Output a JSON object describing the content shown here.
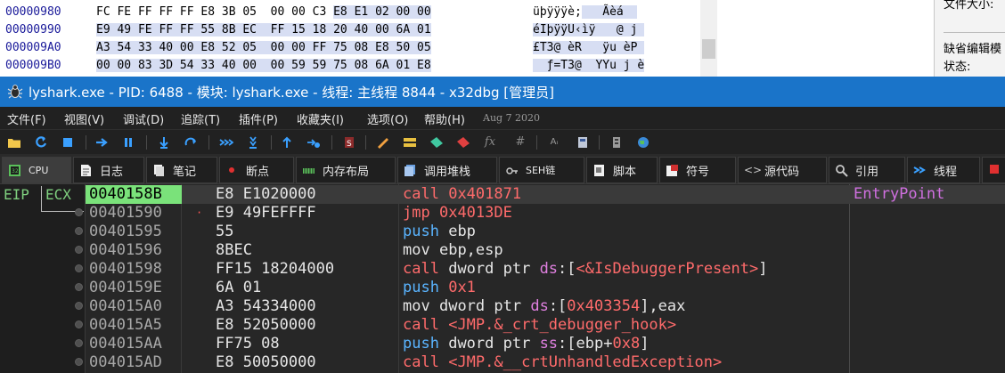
{
  "hexdump": {
    "rows": [
      {
        "addr": "00000980",
        "bytes_a": "FC FE FF FF FF E8 3B 05  00 00 C3 ",
        "bytes_b": "E8 E1 02 00 00",
        "ascii_a": "üþÿÿÿè;",
        "ascii_b": "   Ãèá  "
      },
      {
        "addr": "00000990",
        "bytes_a": "",
        "bytes_b": "E9 49 FE FF FF 55 8B EC  FF 15 18 20 40 00 6A 01",
        "ascii_a": "",
        "ascii_b": "éIþÿÿU‹ìÿ   @ j "
      },
      {
        "addr": "000009A0",
        "bytes_a": "",
        "bytes_b": "A3 54 33 40 00 E8 52 05  00 00 FF 75 08 E8 50 05",
        "ascii_a": "",
        "ascii_b": "£T3@ èR   ÿu èP "
      },
      {
        "addr": "000009B0",
        "bytes_a": "",
        "bytes_b": "00 00 83 3D 54 33 40 00  00 59 59 75 08 6A 01 E8",
        "ascii_a": "",
        "ascii_b": "  ƒ=T3@  YYu j è"
      }
    ]
  },
  "right_panel": {
    "line1": "文件大小:",
    "line2": "缺省编辑模",
    "line3": "状态:"
  },
  "titlebar": {
    "title": "lyshark.exe - PID: 6488 - 模块: lyshark.exe - 线程: 主线程 8844 - x32dbg [管理员]"
  },
  "menu": {
    "items": [
      "文件(F)",
      "视图(V)",
      "调试(D)",
      "追踪(T)",
      "插件(P)",
      "收藏夹(I)",
      "选项(O)",
      "帮助(H)"
    ],
    "date": "Aug 7 2020"
  },
  "toolbar": {
    "icons": [
      "open-icon",
      "restart-icon",
      "stop-icon",
      "run-icon",
      "pause-icon",
      "step-into-icon",
      "step-over-icon",
      "trace-into-icon",
      "trace-over-icon",
      "execute-till-return-icon",
      "run-to-user-code-icon",
      "scylla-icon",
      "patch-icon",
      "comment-icon",
      "label-icon",
      "bookmark-icon",
      "function-icon",
      "hash-icon",
      "font-icon",
      "calculator-icon",
      "memory-icon",
      "globe-icon"
    ]
  },
  "tabs": [
    {
      "id": "cpu",
      "label": "CPU",
      "icon": "cpu-icon"
    },
    {
      "id": "log",
      "label": "日志",
      "icon": "log-icon"
    },
    {
      "id": "notes",
      "label": "笔记",
      "icon": "notes-icon"
    },
    {
      "id": "breakpoints",
      "label": "断点",
      "icon": "breakpoint-icon"
    },
    {
      "id": "memory-map",
      "label": "内存布局",
      "icon": "memory-map-icon"
    },
    {
      "id": "call-stack",
      "label": "调用堆栈",
      "icon": "call-stack-icon"
    },
    {
      "id": "seh",
      "label": "SEH链",
      "icon": "seh-icon"
    },
    {
      "id": "script",
      "label": "脚本",
      "icon": "script-icon"
    },
    {
      "id": "symbols",
      "label": "符号",
      "icon": "symbols-icon"
    },
    {
      "id": "source",
      "label": "源代码",
      "icon": "source-icon"
    },
    {
      "id": "references",
      "label": "引用",
      "icon": "references-icon"
    },
    {
      "id": "threads",
      "label": "线程",
      "icon": "threads-icon"
    }
  ],
  "registers": {
    "eip": "EIP",
    "ecx": "ECX"
  },
  "disasm": {
    "comment": "EntryPoint",
    "rows": [
      {
        "addr": "0040158B",
        "bytes": "E8 E1020000",
        "mnem": "call",
        "ops": [
          {
            "t": "num",
            "v": "0x401871"
          }
        ]
      },
      {
        "addr": "00401590",
        "bytes": "E9 49FEFFFF",
        "mnem": "jmp",
        "ops": [
          {
            "t": "num",
            "v": "0x4013DE"
          }
        ]
      },
      {
        "addr": "00401595",
        "bytes": "55",
        "mnem": "push",
        "ops": [
          {
            "t": "plain",
            "v": "ebp"
          }
        ]
      },
      {
        "addr": "00401596",
        "bytes": "8BEC",
        "mnem": "mov",
        "ops": [
          {
            "t": "plain",
            "v": "ebp,esp"
          }
        ]
      },
      {
        "addr": "00401598",
        "bytes": "FF15 18204000",
        "mnem": "call",
        "ops": [
          {
            "t": "plain",
            "v": "dword ptr "
          },
          {
            "t": "seg",
            "v": "ds"
          },
          {
            "t": "plain",
            "v": ":["
          },
          {
            "t": "sym",
            "v": "<&IsDebuggerPresent>"
          },
          {
            "t": "plain",
            "v": "]"
          }
        ]
      },
      {
        "addr": "0040159E",
        "bytes": "6A 01",
        "mnem": "push",
        "ops": [
          {
            "t": "num",
            "v": "0x1"
          }
        ]
      },
      {
        "addr": "004015A0",
        "bytes": "A3 54334000",
        "mnem": "mov",
        "ops": [
          {
            "t": "plain",
            "v": "dword ptr "
          },
          {
            "t": "seg",
            "v": "ds"
          },
          {
            "t": "plain",
            "v": ":["
          },
          {
            "t": "num",
            "v": "0x403354"
          },
          {
            "t": "plain",
            "v": "],eax"
          }
        ]
      },
      {
        "addr": "004015A5",
        "bytes": "E8 52050000",
        "mnem": "call",
        "ops": [
          {
            "t": "sym",
            "v": "<JMP.&_crt_debugger_hook>"
          }
        ]
      },
      {
        "addr": "004015AA",
        "bytes": "FF75 08",
        "mnem": "push",
        "ops": [
          {
            "t": "plain",
            "v": "dword ptr "
          },
          {
            "t": "seg",
            "v": "ss"
          },
          {
            "t": "plain",
            "v": ":[ebp+"
          },
          {
            "t": "num",
            "v": "0x8"
          },
          {
            "t": "plain",
            "v": "]"
          }
        ]
      },
      {
        "addr": "004015AD",
        "bytes": "E8 50050000",
        "mnem": "call",
        "ops": [
          {
            "t": "sym",
            "v": "<JMP.&__crtUnhandledException>"
          }
        ]
      }
    ]
  }
}
